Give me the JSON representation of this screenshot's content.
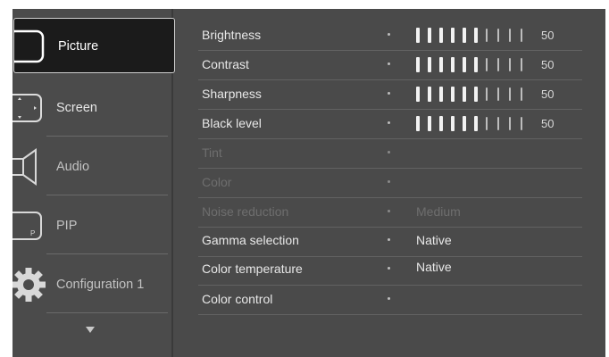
{
  "sidebar": {
    "items": [
      {
        "label": "Picture",
        "icon": "picture-icon",
        "selected": true
      },
      {
        "label": "Screen",
        "icon": "screen-icon",
        "selected": false
      },
      {
        "label": "Audio",
        "icon": "speaker-icon",
        "selected": false
      },
      {
        "label": "PIP",
        "icon": "pip-icon",
        "selected": false
      },
      {
        "label": "Configuration 1",
        "icon": "gear-icon",
        "selected": false
      }
    ],
    "scroll_icon": "arrow-down-icon"
  },
  "settings": [
    {
      "name": "Brightness",
      "level": 0.5,
      "number": "50",
      "enabled": true
    },
    {
      "name": "Contrast",
      "level": 0.5,
      "number": "50",
      "enabled": true
    },
    {
      "name": "Sharpness",
      "level": 0.5,
      "number": "50",
      "enabled": true
    },
    {
      "name": "Black level",
      "level": 0.5,
      "number": "50",
      "enabled": true
    },
    {
      "name": "Tint",
      "enabled": false
    },
    {
      "name": "Color",
      "enabled": false
    },
    {
      "name": "Noise reduction",
      "value": "Medium",
      "enabled": false
    },
    {
      "name": "Gamma selection",
      "value": "Native",
      "enabled": true
    },
    {
      "name": "Color temperature",
      "value": "Native",
      "enabled": true
    },
    {
      "name": "Color control",
      "enabled": true
    }
  ],
  "colors": {
    "panel": "#4a4a4a",
    "selected_bg": "#1b1b1b",
    "text": "#e8e8e8",
    "disabled_text": "#6e6e6e"
  }
}
